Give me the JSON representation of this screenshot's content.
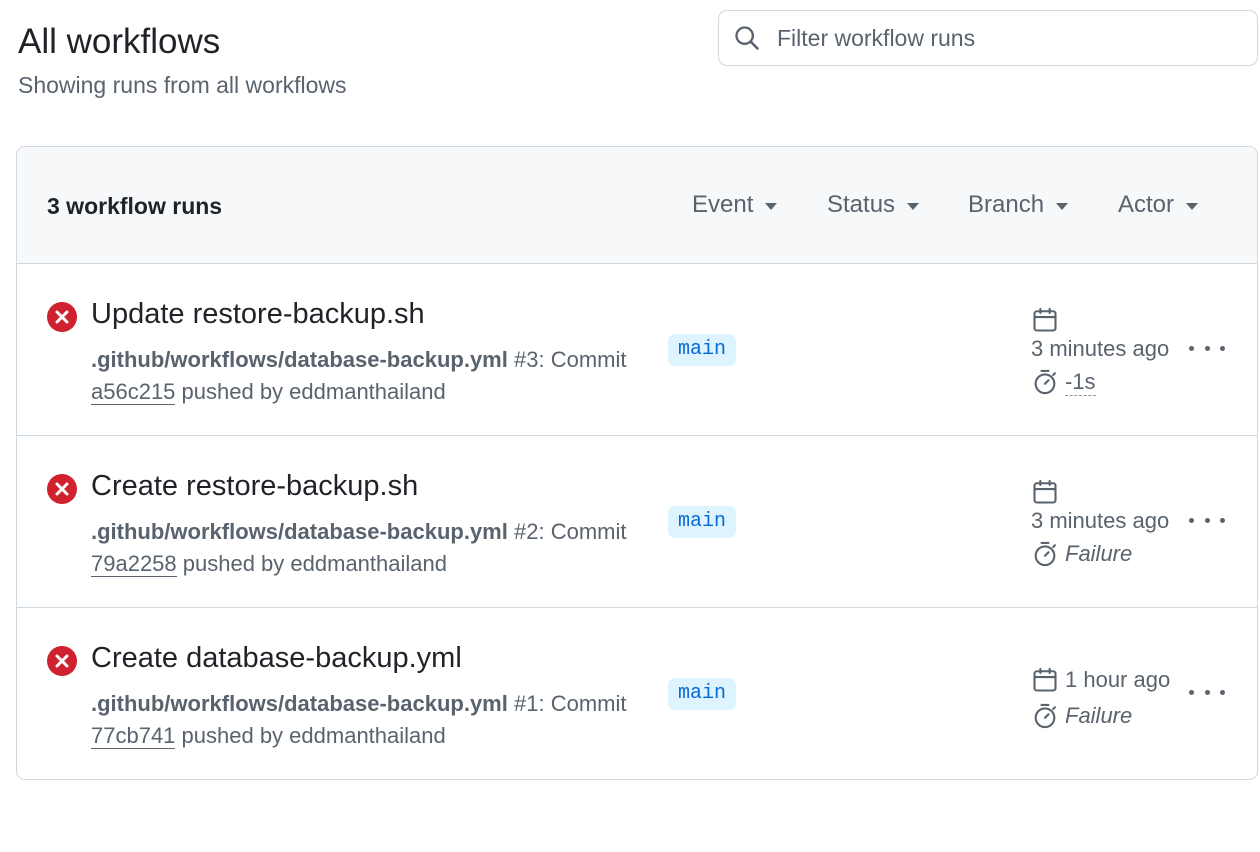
{
  "header": {
    "title": "All workflows",
    "subtitle": "Showing runs from all workflows"
  },
  "search": {
    "placeholder": "Filter workflow runs",
    "icon": "search-icon"
  },
  "list": {
    "count_label": "3 workflow runs",
    "filters": [
      "Event",
      "Status",
      "Branch",
      "Actor"
    ]
  },
  "runs": [
    {
      "title": "Update restore-backup.sh",
      "workflow_path": ".github/workflows/database-backup.yml",
      "run_number": "#3",
      "commit_label": ": Commit",
      "sha": "a56c215",
      "pushed_by": " pushed by eddmanthailand",
      "branch": "main",
      "time": "3 minutes ago",
      "duration": "-1s",
      "status": "failure"
    },
    {
      "title": "Create restore-backup.sh",
      "workflow_path": ".github/workflows/database-backup.yml",
      "run_number": "#2",
      "commit_label": ": Commit",
      "sha": "79a2258",
      "pushed_by": " pushed by eddmanthailand",
      "branch": "main",
      "time": "3 minutes ago",
      "duration": "Failure",
      "status": "failure"
    },
    {
      "title": "Create database-backup.yml",
      "workflow_path": ".github/workflows/database-backup.yml",
      "run_number": "#1",
      "commit_label": ": Commit",
      "sha": "77cb741",
      "pushed_by": " pushed by eddmanthailand",
      "branch": "main",
      "time": "1 hour ago",
      "duration": "Failure",
      "status": "failure"
    }
  ],
  "colors": {
    "failure": "#cf222e",
    "branch_bg": "#ddf4ff",
    "branch_fg": "#0969da",
    "muted": "#59636e",
    "border": "#d1d9e0"
  }
}
